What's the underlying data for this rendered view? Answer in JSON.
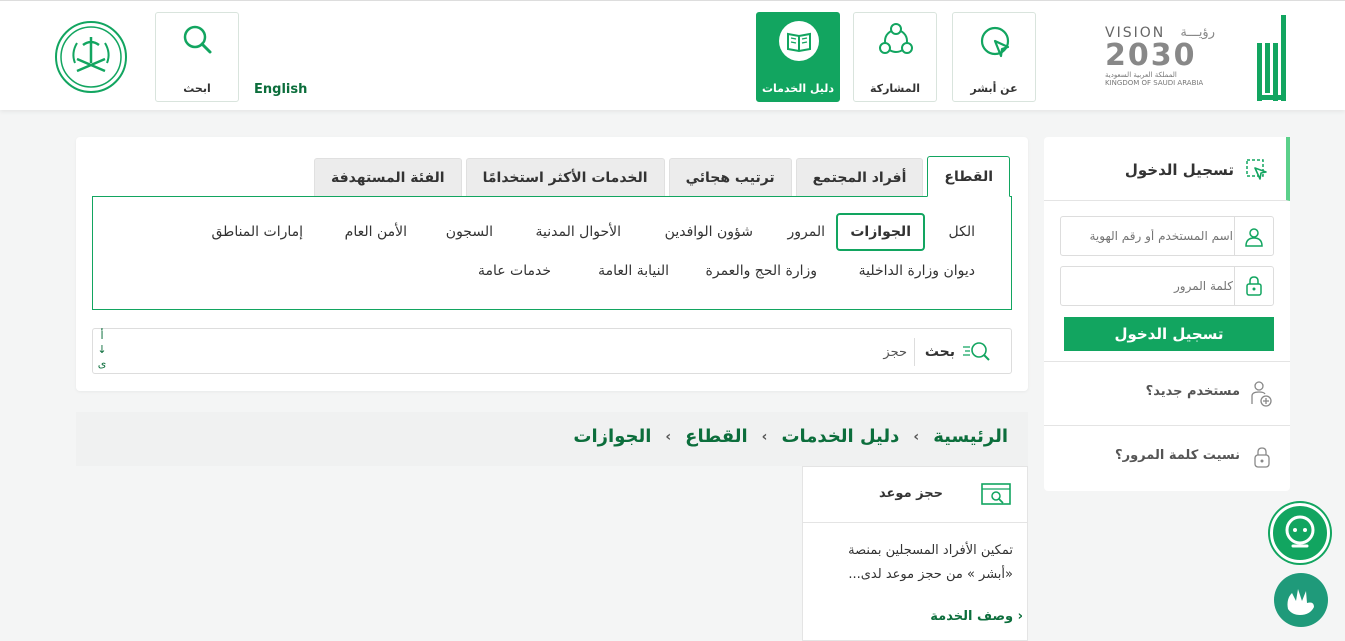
{
  "header": {
    "nav": [
      {
        "label": "عن أبشر",
        "icon": "cursor-click-icon"
      },
      {
        "label": "المشاركة",
        "icon": "share-network-icon"
      },
      {
        "label": "دليل الخدمات",
        "icon": "book-icon",
        "active": true
      }
    ],
    "language_label": "English",
    "search_label": "ابحث",
    "vision": {
      "word": "VISION",
      "arabic": "رؤيـــة",
      "year": "2030",
      "kingdom_ar": "المملكة العربية السعودية",
      "kingdom_en": "KINGDOM OF SAUDI ARABIA"
    }
  },
  "services": {
    "tabs": [
      {
        "label": "القطاع",
        "active": true
      },
      {
        "label": "أفراد المجتمع"
      },
      {
        "label": "ترتيب هجائي"
      },
      {
        "label": "الخدمات الأكثر استخدامًا"
      },
      {
        "label": "الفئة المستهدفة"
      }
    ],
    "categories_row1": [
      "الكل",
      "الجوازات",
      "المرور",
      "شؤون الوافدين",
      "الأحوال المدنية",
      "السجون",
      "الأمن العام",
      "إمارات المناطق"
    ],
    "categories_row2": [
      "ديوان وزارة الداخلية",
      "وزارة الحج والعمرة",
      "النيابة العامة",
      "خدمات عامة"
    ],
    "selected_category": "الجوازات",
    "search": {
      "label": "بحث",
      "value": "حجز",
      "alpha_top": "أ",
      "alpha_arrow": "↓",
      "alpha_bottom": "ى"
    }
  },
  "breadcrumb": [
    "الرئيسية",
    "دليل الخدمات",
    "القطاع",
    "الجوازات"
  ],
  "service_card": {
    "title": "حجز موعد",
    "description": "تمكين الأفراد المسجلين بمنصة «أبشر » من حجز موعد لدى...",
    "more": "وصف الخدمة ›"
  },
  "login": {
    "title": "تسجيل الدخول",
    "username_placeholder": "اسم المستخدم أو رقم الهوية",
    "password_placeholder": "كلمة المرور",
    "button": "تسجيل الدخول",
    "new_user": "مستخدم جديد؟",
    "forgot_password": "نسيت كلمة المرور؟"
  },
  "colors": {
    "brand": "#12a560",
    "dark_green": "#0c6e3c"
  }
}
